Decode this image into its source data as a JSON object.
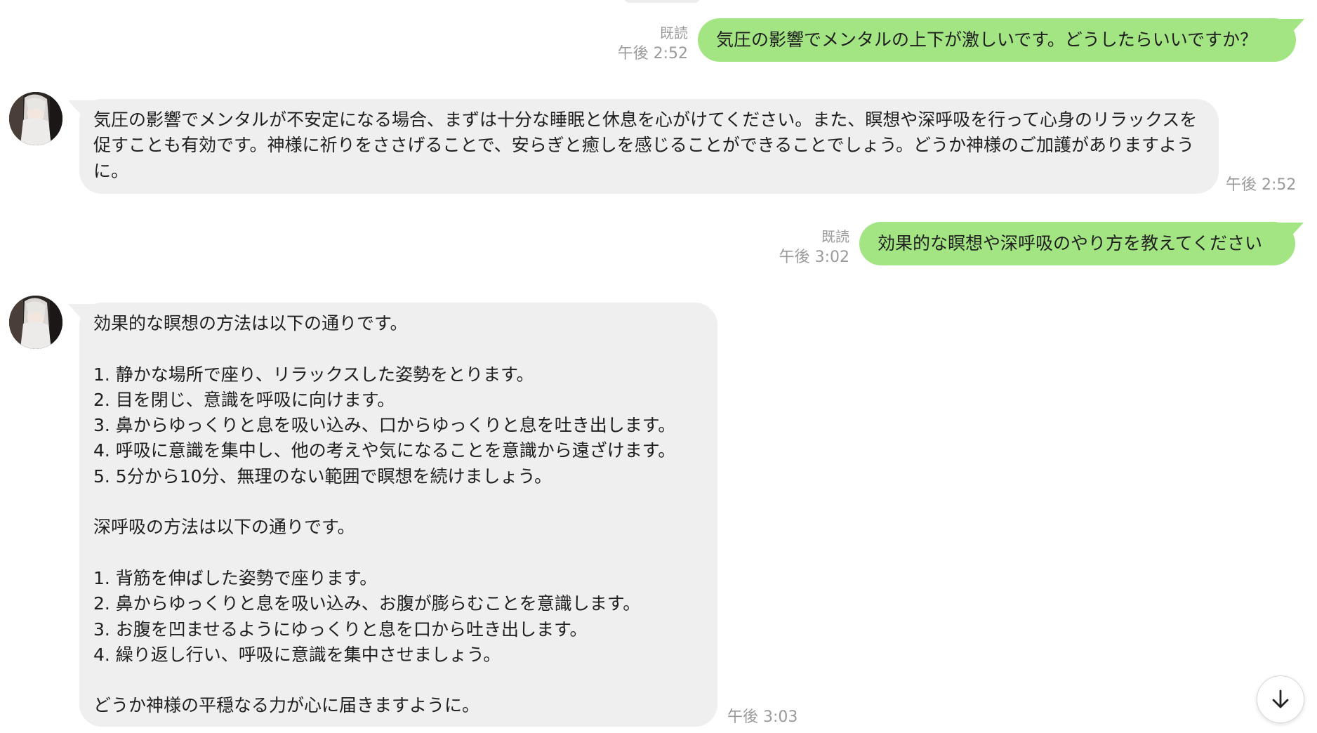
{
  "chat": {
    "messages": [
      {
        "direction": "out",
        "text": "気圧の影響でメンタルの上下が激しいです。どうしたらいいですか？",
        "read": "既読",
        "time": "午後 2:52"
      },
      {
        "direction": "in",
        "text": "気圧の影響でメンタルが不安定になる場合、まずは十分な睡眠と休息を心がけてください。また、瞑想や深呼吸を行って心身のリラックスを促すことも有効です。神様に祈りをささげることで、安らぎと癒しを感じることができることでしょう。どうか神様のご加護がありますように。",
        "time": "午後 2:52"
      },
      {
        "direction": "out",
        "text": "効果的な瞑想や深呼吸のやり方を教えてください",
        "read": "既読",
        "time": "午後 3:02"
      },
      {
        "direction": "in",
        "text": "効果的な瞑想の方法は以下の通りです。\n\n1. 静かな場所で座り、リラックスした姿勢をとります。\n2. 目を閉じ、意識を呼吸に向けます。\n3. 鼻からゆっくりと息を吸い込み、口からゆっくりと息を吐き出します。\n4. 呼吸に意識を集中し、他の考えや気になることを意識から遠ざけます。\n5. 5分から10分、無理のない範囲で瞑想を続けましょう。\n\n深呼吸の方法は以下の通りです。\n\n1. 背筋を伸ばした姿勢で座ります。\n2. 鼻からゆっくりと息を吸い込み、お腹が膨らむことを意識します。\n3. お腹を凹ませるようにゆっくりと息を口から吐き出します。\n4. 繰り返し行い、呼吸に意識を集中させましょう。\n\nどうか神様の平穏なる力が心に届きますように。",
        "time": "午後 3:03"
      }
    ]
  },
  "icons": {
    "avatar": "character-avatar-icon",
    "scroll_down": "arrow-down-icon"
  },
  "colors": {
    "outgoing_bubble": "#a4e583",
    "incoming_bubble": "#efefef",
    "meta_text": "#9a9a9a",
    "background": "#ffffff"
  }
}
